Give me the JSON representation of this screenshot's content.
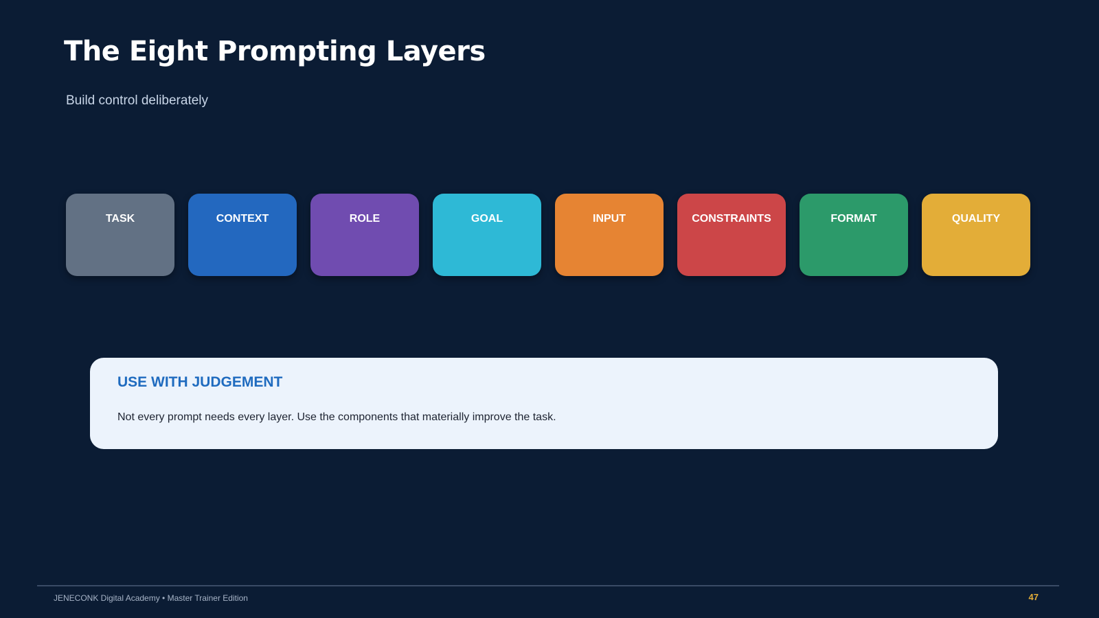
{
  "slide": {
    "title": "The Eight Prompting Layers",
    "subtitle": "Build control deliberately"
  },
  "layers": [
    {
      "label": "TASK",
      "color": "#627184"
    },
    {
      "label": "CONTEXT",
      "color": "#2368bf"
    },
    {
      "label": "ROLE",
      "color": "#704cb0"
    },
    {
      "label": "GOAL",
      "color": "#2eb9d6"
    },
    {
      "label": "INPUT",
      "color": "#e68433"
    },
    {
      "label": "CONSTRAINTS",
      "color": "#cc4648"
    },
    {
      "label": "FORMAT",
      "color": "#2c9a6a"
    },
    {
      "label": "QUALITY",
      "color": "#e3ad38"
    }
  ],
  "note": {
    "title": "USE WITH JUDGEMENT",
    "text": "Not every prompt needs every layer. Use the components that materially improve the task."
  },
  "footer": {
    "text": "JENECONK Digital Academy  •  Master Trainer Edition",
    "page_number": "47"
  }
}
